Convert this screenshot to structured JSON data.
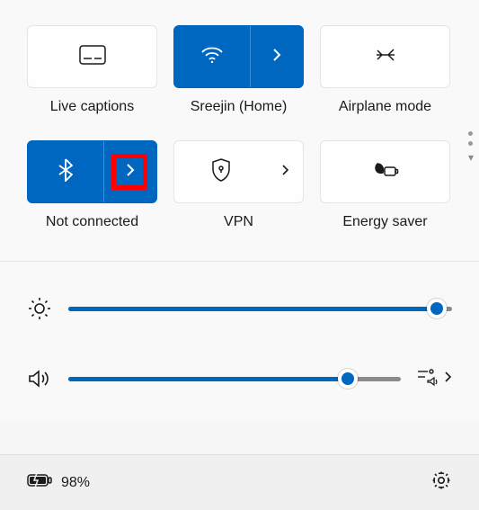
{
  "tiles": {
    "live_captions": {
      "label": "Live captions"
    },
    "wifi": {
      "label": "Sreejin (Home)"
    },
    "airplane": {
      "label": "Airplane mode"
    },
    "bluetooth": {
      "label": "Not connected"
    },
    "vpn": {
      "label": "VPN"
    },
    "energy_saver": {
      "label": "Energy saver"
    }
  },
  "sliders": {
    "brightness": {
      "value": 96
    },
    "volume": {
      "value": 84
    }
  },
  "bottom": {
    "battery_text": "98%"
  },
  "colors": {
    "accent": "#0067c0",
    "highlight": "#ff0000"
  }
}
